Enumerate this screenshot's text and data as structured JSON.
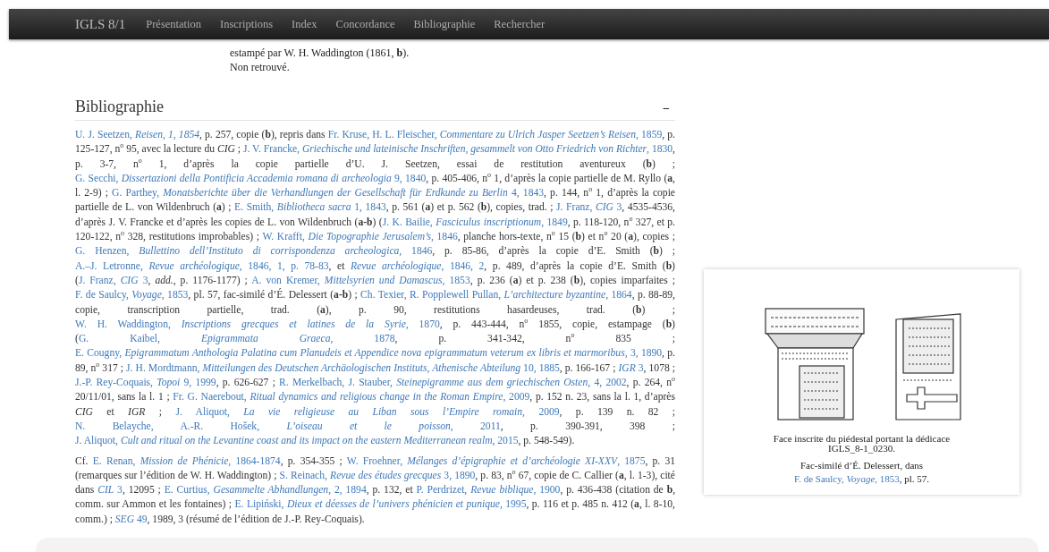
{
  "navbar": {
    "brand": "IGLS 8/1",
    "items": [
      "Présentation",
      "Inscriptions",
      "Index",
      "Concordance",
      "Bibliographie",
      "Rechercher"
    ]
  },
  "notice_lines": [
    "estampé par W. H. Waddington (1861, **b**).",
    "Non retrouvé."
  ],
  "bibliography": {
    "title": "Bibliographie",
    "toggle": "−",
    "paragraphs": [
      [
        {
          "kind": "link",
          "text": "U. J. Seetzen, *Reisen, 1, 1854*"
        },
        {
          "kind": "text",
          "text": ", p. 257, copie (**b**), repris dans "
        },
        {
          "kind": "link",
          "text": "Fr. Kruse, H. L. Fleischer, *Commentare zu Ulrich Jasper Seetzen’s Reisen,* 1859"
        },
        {
          "kind": "text",
          "text": ", p. 125-127, n$^{o}$ 95, avec la lecture du *CIG* ; "
        },
        {
          "kind": "link",
          "text": "J. V. Francke, *Griechische und lateinische Inschriften, gesammelt von Otto Friedrich von Richter*, 1830"
        },
        {
          "kind": "text",
          "text": ", p. 3-7, n$^{o}$ 1, d’après la copie partielle d’U. J. Seetzen, essai de restitution aventureux (**b**) ; "
        },
        {
          "kind": "link",
          "text": "G. Secchi, *Dissertazioni della Pontificia Accademia romana di archeologia* 9, 1840"
        },
        {
          "kind": "text",
          "text": ", p. 405-406, n$^{o}$ 1, d’après la copie partielle de M. Ryllo (**a**, l. 2-9) ; "
        },
        {
          "kind": "link",
          "text": "G. Parthey, *Monatsberichte über die Verhandlungen der Gesellschaft für Erdkunde zu Berlin* 4, 1843"
        },
        {
          "kind": "text",
          "text": ", p. 144, n$^{o}$ 1, d’après la copie partielle de L. von Wildenbruch (**a**) ; "
        },
        {
          "kind": "link",
          "text": "E. Smith, *Bibliotheca sacra* 1, 1843"
        },
        {
          "kind": "text",
          "text": ", p. 561 (**a**) et p. 562 (**b**), copies, trad. ; "
        },
        {
          "kind": "link",
          "text": "J. Franz, *CIG* 3"
        },
        {
          "kind": "text",
          "text": ", 4535-4536, d’après J. V. Francke et d’après les copies de L. von Wildenbruch (**a-b**) ("
        },
        {
          "kind": "link",
          "text": "J. K. Bailie, *Fasciculus inscriptionum*, 1849"
        },
        {
          "kind": "text",
          "text": ", p. 118-120, n$^{o}$ 327, et p. 120-122, n$^{o}$ 328, restitutions improbables) ; "
        },
        {
          "kind": "link",
          "text": "W. Krafft, *Die Topographie Jerusalem’s*, 1846"
        },
        {
          "kind": "text",
          "text": ", planche hors-texte, n$^{o}$ 15 (**b**) et n$^{o}$ 20 (**a**), copies ; "
        },
        {
          "kind": "link",
          "text": "G. Henzen, *Bullettino dell’Instituto di corrispondenza archeologica*, 1846"
        },
        {
          "kind": "text",
          "text": ", p. 85-86, d’après la copie d’E. Smith (**b**) ; "
        },
        {
          "kind": "link",
          "text": "A.–J. Letronne, *Revue archéologique*, 1846, 1, p. 78-83"
        },
        {
          "kind": "text",
          "text": ", et "
        },
        {
          "kind": "link",
          "text": "*Revue archéologique*, 1846, 2"
        },
        {
          "kind": "text",
          "text": ", p. 489, d’après la copie d’E. Smith (**b**) ("
        },
        {
          "kind": "link",
          "text": "J. Franz, *CIG* 3"
        },
        {
          "kind": "text",
          "text": ", *add.*, p. 1176-1177) ; "
        },
        {
          "kind": "link",
          "text": "A. von Kremer, *Mittelsyrien und Damascus*, 1853"
        },
        {
          "kind": "text",
          "text": ", p. 236 (**a**) et p. 238 (**b**), copies imparfaites ; "
        },
        {
          "kind": "link",
          "text": "F. de Saulcy, *Voyage*, 1853"
        },
        {
          "kind": "text",
          "text": ", pl. 57, fac-similé d’É. Delessert (**a-b**) ; "
        },
        {
          "kind": "link",
          "text": "Ch. Texier, R. Popplewell Pullan, *L’architecture byzantine*, 1864"
        },
        {
          "kind": "text",
          "text": ", p. 88-89, copie, transcription partielle, trad. (**a**), p. 90, restitutions hasardeuses, trad. (**b**) ; "
        },
        {
          "kind": "link",
          "text": "W. H. Waddington, *Inscriptions grecques et latines de la Syrie*, 1870"
        },
        {
          "kind": "text",
          "text": ", p. 443-444, n$^{o}$ 1855, copie, estampage (**b**) ("
        },
        {
          "kind": "link",
          "text": "G. Kaibel, *Epigrammata Graeca*, 1878"
        },
        {
          "kind": "text",
          "text": ", p. 341-342, n$^{o}$ 835 ; "
        },
        {
          "kind": "link",
          "text": "E. Cougny, *Epigrammatum Anthologia Palatina cum Planudeis et Appendice nova epigrammatum veterum ex libris et marmoribus*, 3, 1890"
        },
        {
          "kind": "text",
          "text": ", p. 89, n$^{o}$ 317 ; "
        },
        {
          "kind": "link",
          "text": "J. H. Mordtmann, *Mitteilungen des Deutschen Archäologischen Instituts, Athenische Abteilung* 10, 1885"
        },
        {
          "kind": "text",
          "text": ", p. 166-167 ; "
        },
        {
          "kind": "link",
          "text": "*IGR* 3"
        },
        {
          "kind": "text",
          "text": ", 1078 ; "
        },
        {
          "kind": "link",
          "text": "J.-P. Rey-Coquais, *Topoi* 9, 1999"
        },
        {
          "kind": "text",
          "text": ", p. 626-627 ; "
        },
        {
          "kind": "link",
          "text": "R. Merkelbach, J. Stauber, *Steinepigramme aus dem griechischen Osten*, 4, 2002"
        },
        {
          "kind": "text",
          "text": ", p. 264, n$^{o}$ 20/11/01, sans la l. 1 ; "
        },
        {
          "kind": "link",
          "text": "Fr. G. Naerebout, *Ritual dynamics and religious change in the Roman Empire*, 2009"
        },
        {
          "kind": "text",
          "text": ", p. 152 n. 23, sans la l. 1, d’après *CIG* et *IGR* ; "
        },
        {
          "kind": "link",
          "text": "J. Aliquot, *La vie religieuse au Liban sous l’Empire romain*, 2009"
        },
        {
          "kind": "text",
          "text": ", p. 139 n. 82 ; "
        },
        {
          "kind": "link",
          "text": "N. Belayche, A.-R. Hošek, *L’oiseau et le poisson*, 2011"
        },
        {
          "kind": "text",
          "text": ", p. 390-391, 398 ; "
        },
        {
          "kind": "link",
          "text": "J. Aliquot, *Cult and ritual on the Levantine coast and its impact on the eastern Mediterranean realm*, 2015"
        },
        {
          "kind": "text",
          "text": ", p. 548-549)."
        }
      ],
      [
        {
          "kind": "text",
          "text": "Cf. "
        },
        {
          "kind": "link",
          "text": "E. Renan, *Mission de Phénicie*, 1864-1874"
        },
        {
          "kind": "text",
          "text": ", p. 354-355 ; "
        },
        {
          "kind": "link",
          "text": "W. Froehner, *Mélanges d’épigraphie et d’archéologie XI-XXV*, 1875"
        },
        {
          "kind": "text",
          "text": ", p. 31 (remarques sur l’édition de W. H. Waddington) ; "
        },
        {
          "kind": "link",
          "text": "S. Reinach, *Revue des études grecques* 3, 1890"
        },
        {
          "kind": "text",
          "text": ", p. 83, n$^{o}$ 67, copie de C. Callier (**a**, l. 1-3), cité dans "
        },
        {
          "kind": "link",
          "text": "*CIL* 3"
        },
        {
          "kind": "text",
          "text": ", 12095 ; "
        },
        {
          "kind": "link",
          "text": "E. Curtius, *Gesammelte Abhandlungen*, 2, 1894"
        },
        {
          "kind": "text",
          "text": ", p. 132, et "
        },
        {
          "kind": "link",
          "text": "P. Perdrizet, *Revue biblique*, 1900"
        },
        {
          "kind": "text",
          "text": ", p. 436-438 (citation de **b**, comm. sur Ammon et les fontaines) ; "
        },
        {
          "kind": "link",
          "text": "E. Lipiński, *Dieux et déesses de l’univers phénicien et punique*, 1995"
        },
        {
          "kind": "text",
          "text": ", p. 116 et p. 485 n. 412 (**a**, l. 8-10, comm.) ; "
        },
        {
          "kind": "link",
          "text": "*SEG* 49"
        },
        {
          "kind": "text",
          "text": ", 1989, 3 (résumé de l’édition de J.-P. Rey-Coquais)."
        }
      ]
    ]
  },
  "figure": {
    "caption": "Face inscrite du piédestal portant la dédicace IGLS_8-1_0230.",
    "credit": [
      {
        "kind": "text",
        "text": "Fac-similé d’É. Delessert, dans "
      },
      {
        "kind": "link",
        "text": "F. de Saulcy, *Voyage*, 1853"
      },
      {
        "kind": "text",
        "text": ", pl. 57."
      }
    ]
  }
}
